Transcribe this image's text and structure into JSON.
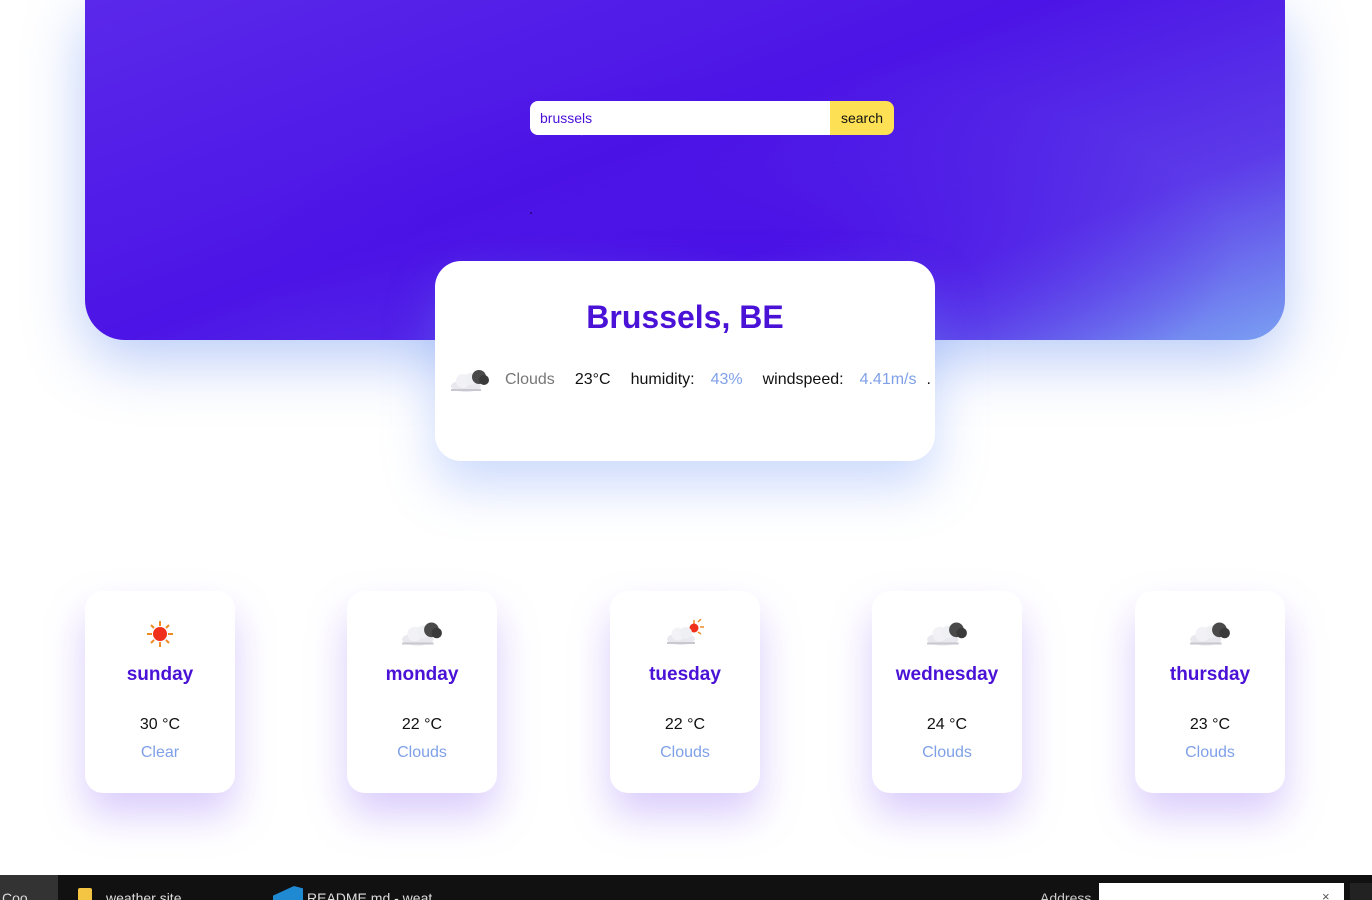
{
  "search": {
    "value": "brussels",
    "button_label": "search"
  },
  "current": {
    "city": "Brussels, BE",
    "condition": "Clouds",
    "temperature": "23°C",
    "humidity_label": "humidity:",
    "humidity_value": "43%",
    "windspeed_label": "windspeed:",
    "windspeed_value": "4.41m/s",
    "trailing": ".",
    "icon": "cloud-icon"
  },
  "forecast": [
    {
      "day": "sunday",
      "temp": "30 °C",
      "condition": "Clear",
      "icon": "sun-icon"
    },
    {
      "day": "monday",
      "temp": "22 °C",
      "condition": "Clouds",
      "icon": "cloud-icon"
    },
    {
      "day": "tuesday",
      "temp": "22 °C",
      "condition": "Clouds",
      "icon": "partly-cloudy-icon"
    },
    {
      "day": "wednesday",
      "temp": "24 °C",
      "condition": "Clouds",
      "icon": "cloud-icon"
    },
    {
      "day": "thursday",
      "temp": "23 °C",
      "condition": "Clouds",
      "icon": "cloud-icon"
    }
  ],
  "taskbar": {
    "start_label": "Coo",
    "items": [
      "weather site",
      "README.md - weat"
    ],
    "address_label": "Address",
    "close_glyph": "×"
  },
  "colors": {
    "accent": "#4a12d6",
    "hero": "#4c14e6",
    "button": "#fde054",
    "secondary_text": "#7fa0e8"
  }
}
